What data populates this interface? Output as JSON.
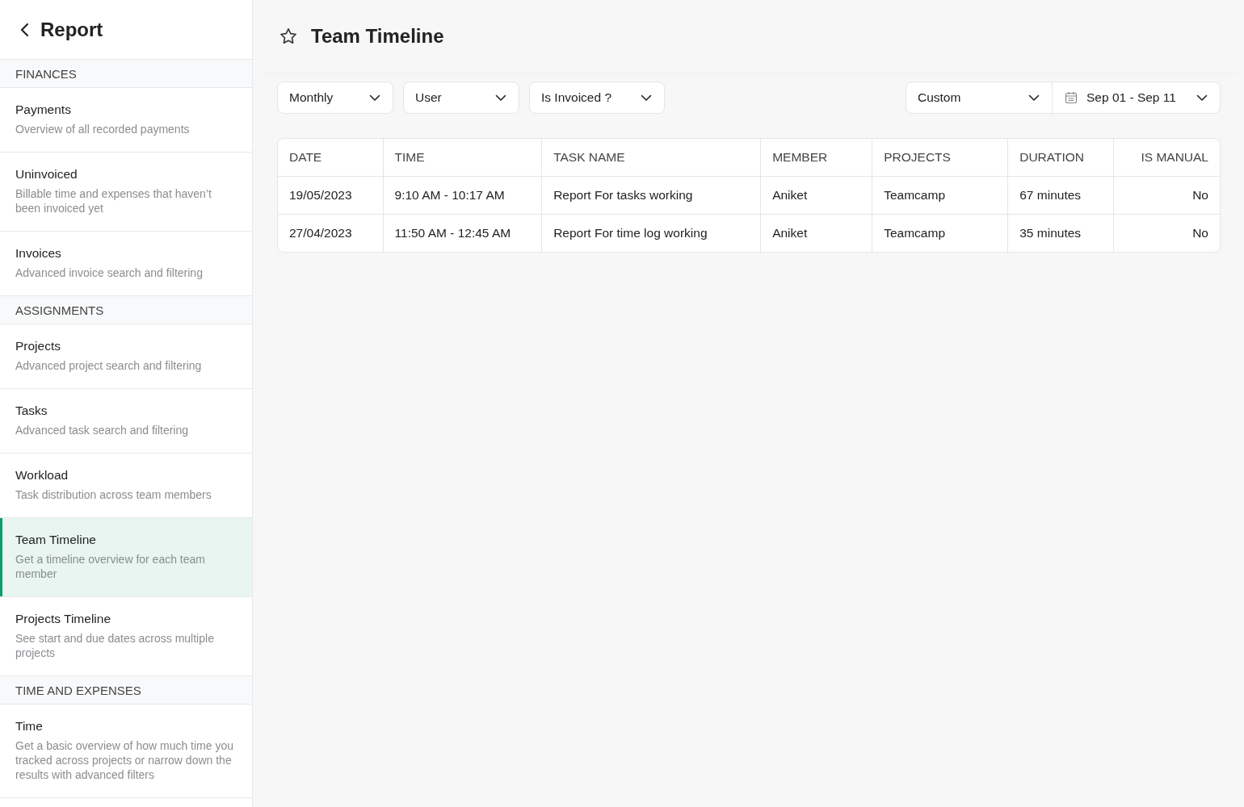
{
  "sidebar": {
    "back_title": "Report",
    "sections": [
      {
        "heading": "FINANCES",
        "items": [
          {
            "title": "Payments",
            "description": "Overview of all recorded payments",
            "selected": false
          },
          {
            "title": "Uninvoiced",
            "description": "Billable time and expenses that haven’t been invoiced yet",
            "selected": false
          },
          {
            "title": "Invoices",
            "description": "Advanced invoice search and filtering",
            "selected": false
          }
        ]
      },
      {
        "heading": "ASSIGNMENTS",
        "items": [
          {
            "title": "Projects",
            "description": "Advanced project search and filtering",
            "selected": false
          },
          {
            "title": "Tasks",
            "description": "Advanced task search and filtering",
            "selected": false
          },
          {
            "title": "Workload",
            "description": "Task distribution across team members",
            "selected": false
          },
          {
            "title": "Team Timeline",
            "description": "Get a timeline overview for each team member",
            "selected": true
          },
          {
            "title": "Projects Timeline",
            "description": "See start and due dates across multiple projects",
            "selected": false
          }
        ]
      },
      {
        "heading": "TIME AND EXPENSES",
        "items": [
          {
            "title": "Time",
            "description": "Get a basic overview of how much time you tracked across projects or narrow down the results with advanced filters",
            "selected": false
          }
        ]
      }
    ]
  },
  "page": {
    "title": "Team Timeline"
  },
  "filters": [
    "Monthly",
    "User",
    "Is Invoiced ?"
  ],
  "period": {
    "preset": "Custom",
    "range": "Sep 01 - Sep 11"
  },
  "table": {
    "columns": [
      "DATE",
      "TIME",
      "TASK NAME",
      "MEMBER",
      "PROJECTS",
      "DURATION",
      "IS MANUAL"
    ],
    "rows": [
      [
        "19/05/2023",
        "9:10 AM - 10:17 AM",
        "Report For tasks working",
        "Aniket",
        "Teamcamp",
        "67 minutes",
        "No"
      ],
      [
        "27/04/2023",
        "11:50 AM - 12:45 AM",
        "Report For time log working",
        "Aniket",
        "Teamcamp",
        "35 minutes",
        "No"
      ]
    ]
  }
}
